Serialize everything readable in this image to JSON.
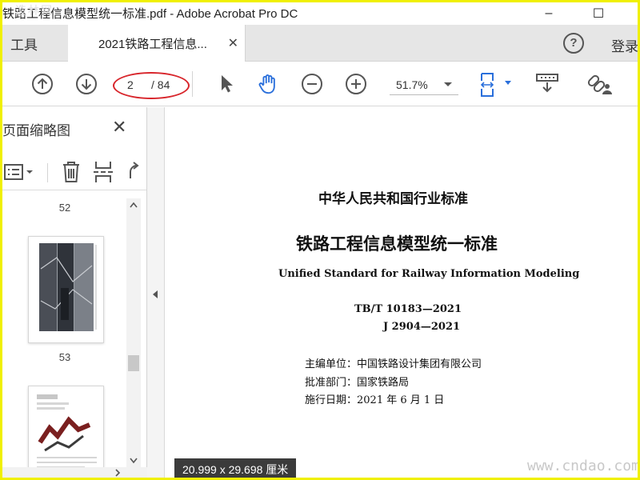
{
  "window": {
    "title": "铁路工程信息模型统一标准.pdf - Adobe Acrobat Pro DC",
    "minimize_glyph": "–",
    "maximize_glyph": "☐"
  },
  "tabs": {
    "tools_label": "工具",
    "document_label": "2021铁路工程信息...",
    "close_glyph": "✕",
    "help_glyph": "?",
    "sign_in_label": "登录"
  },
  "toolbar": {
    "current_page": "2",
    "total_pages": "/ 84",
    "zoom_value": "51.7%",
    "accent_color": "#2a6fdb",
    "highlight_color": "#d8262c"
  },
  "sidebar": {
    "title": "页面缩略图",
    "close_glyph": "✕",
    "thumbnails": [
      {
        "page_label": "52"
      },
      {
        "page_label": "53"
      }
    ]
  },
  "document": {
    "category": "中华人民共和国行业标准",
    "title_cn": "铁路工程信息模型统一标准",
    "title_en": "Unified Standard for Railway Information Modeling",
    "code_1": "TB/T 10183—2021",
    "code_2": "J 2904—2021",
    "editor_line": "主编单位：中国铁路设计集团有限公司",
    "approver_line": "批准部门：国家铁路局",
    "effective_line": "施行日期：2021 年 6 月 1 日"
  },
  "page_size_tip": "20.999 x 29.698 厘米",
  "watermarks": {
    "top_left": "造林网",
    "bottom_right": "www.cndao.com"
  }
}
